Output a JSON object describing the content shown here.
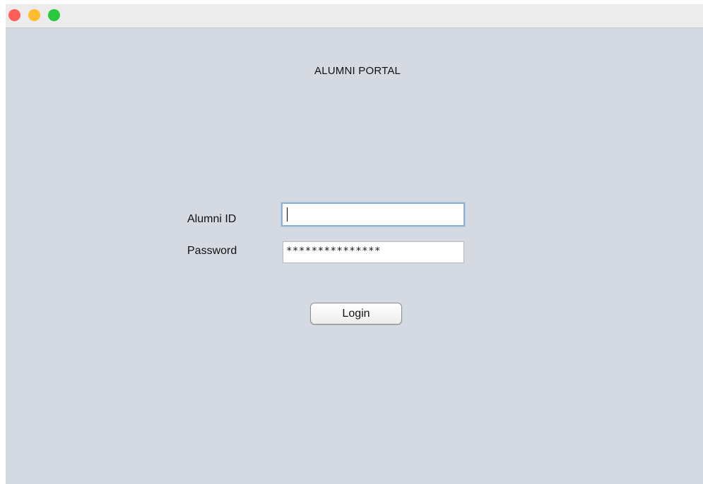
{
  "window": {
    "controls": [
      "close",
      "minimize",
      "zoom"
    ],
    "colors": {
      "background": "#d5d9e1",
      "titlebar": "#ececec",
      "close": "#fe5f57",
      "minimize": "#febc2e",
      "zoom": "#28c840"
    }
  },
  "header": {
    "title": "ALUMNI PORTAL"
  },
  "form": {
    "alumni_id": {
      "label": "Alumni ID",
      "value": ""
    },
    "password": {
      "label": "Password",
      "value": "***************"
    },
    "login_label": "Login"
  }
}
